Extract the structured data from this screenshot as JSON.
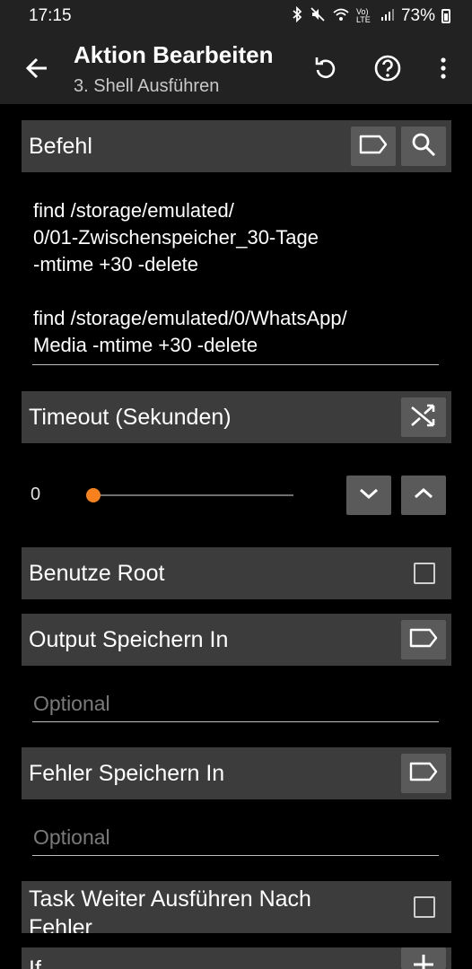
{
  "statusbar": {
    "time": "17:15",
    "network": "Vo) LTE",
    "battery_percent": "73%"
  },
  "appbar": {
    "title": "Aktion Bearbeiten",
    "subtitle": "3. Shell Ausführen"
  },
  "befehl": {
    "label": "Befehl",
    "command_line1": "find /storage/emulated/",
    "command_line2": "0/01-Zwischenspeicher_30-Tage",
    "command_line3": "-mtime +30 -delete",
    "command_line4": "find /storage/emulated/0/WhatsApp/",
    "command_line5": "Media -mtime +30 -delete"
  },
  "timeout": {
    "label": "Timeout (Sekunden)",
    "value": "0",
    "slider_fraction": 0
  },
  "root": {
    "label": "Benutze Root"
  },
  "output": {
    "label": "Output Speichern In",
    "placeholder": "Optional"
  },
  "fehler": {
    "label": "Fehler Speichern In",
    "placeholder": "Optional"
  },
  "continue": {
    "label_line1": "Task Weiter Ausführen Nach",
    "label_line2": "Fehler"
  },
  "if_section": {
    "label": "If"
  },
  "colors": {
    "accent": "#f7821b",
    "header_bg": "#3c3c3c",
    "button_bg": "#5a5a5a"
  }
}
